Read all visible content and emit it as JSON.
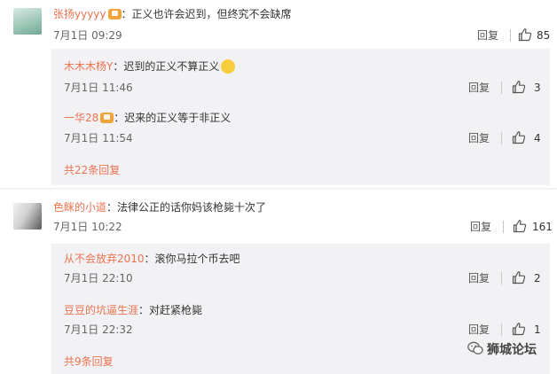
{
  "colors": {
    "username": "#eb7350",
    "text": "#333333",
    "meta": "#666666",
    "reply_bg": "#f2f2f5"
  },
  "comments": [
    {
      "username": "张扬yyyyy",
      "text": "：正义也许会迟到，但终究不会缺席",
      "date": "7月1日 09:29",
      "reply_label": "回复",
      "likes": "85",
      "replies": [
        {
          "username": "木木木杨Y",
          "text": "：迟到的正义不算正义",
          "date": "7月1日 11:46",
          "reply_label": "回复",
          "likes": "3"
        },
        {
          "username": "一华28",
          "text": "：迟来的正义等于非正义",
          "date": "7月1日 11:54",
          "reply_label": "回复",
          "likes": "4"
        }
      ],
      "more_replies": "共22条回复"
    },
    {
      "username": "色眯的小道",
      "text": "：法律公正的话你妈该枪毙十次了",
      "date": "7月1日 10:22",
      "reply_label": "回复",
      "likes": "161",
      "replies": [
        {
          "username": "从不会放弃2010",
          "text": "：滚你马拉个币去吧",
          "date": "7月1日 22:10",
          "reply_label": "回复",
          "likes": "2"
        },
        {
          "username": "豆豆的坑逼生涯",
          "text": "：对赶紧枪毙",
          "date": "7月1日 22:32",
          "reply_label": "回复",
          "likes": "1"
        }
      ],
      "more_replies": "共9条回复"
    }
  ],
  "watermark": {
    "text": "狮城论坛",
    "icon": "wechat-bubble-icon"
  }
}
